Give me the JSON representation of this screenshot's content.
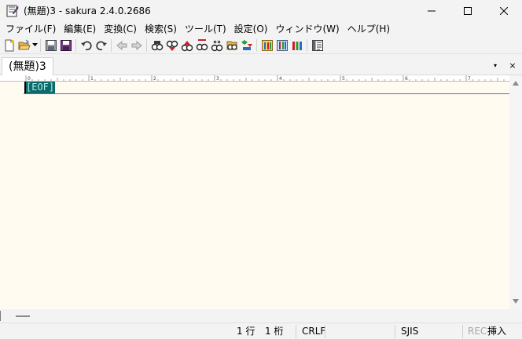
{
  "window": {
    "title": "(無題)3 - sakura 2.4.0.2686",
    "controls": {
      "minimize": "minimize",
      "maximize": "maximize",
      "close": "close"
    }
  },
  "menu": {
    "items": [
      {
        "label": "ファイル(F)"
      },
      {
        "label": "編集(E)"
      },
      {
        "label": "変換(C)"
      },
      {
        "label": "検索(S)"
      },
      {
        "label": "ツール(T)"
      },
      {
        "label": "設定(O)"
      },
      {
        "label": "ウィンドウ(W)"
      },
      {
        "label": "ヘルプ(H)"
      }
    ]
  },
  "toolbar": {
    "icons": [
      "new-file-icon",
      "open-folder-icon",
      "dropdown-icon",
      "save-icon",
      "save-all-icon",
      "undo-icon",
      "redo-icon",
      "jump-back-icon",
      "jump-forward-icon",
      "search-icon",
      "search-next-icon",
      "search-prev-icon",
      "replace-icon",
      "grep-icon",
      "bookmark-icon",
      "settings-common-icon",
      "settings-type-icon",
      "settings-font-icon",
      "outline-icon"
    ]
  },
  "tabs": [
    {
      "label": "(無題)3"
    }
  ],
  "tabbar": {
    "list_glyph": "▾",
    "close_glyph": "×"
  },
  "editor": {
    "eof": "[EOF]",
    "background": "#fffbf0",
    "eof_bg": "#0e6a6a",
    "eof_fg": "#a6f1f1"
  },
  "ruler": {
    "labels": [
      "0",
      "1",
      "2",
      "3",
      "4",
      "5",
      "6",
      "7"
    ]
  },
  "status": {
    "line": "1 行",
    "column": "1 桁",
    "eol": "CRLF",
    "encoding": "SJIS",
    "rec": "REC",
    "mode": "挿入"
  }
}
